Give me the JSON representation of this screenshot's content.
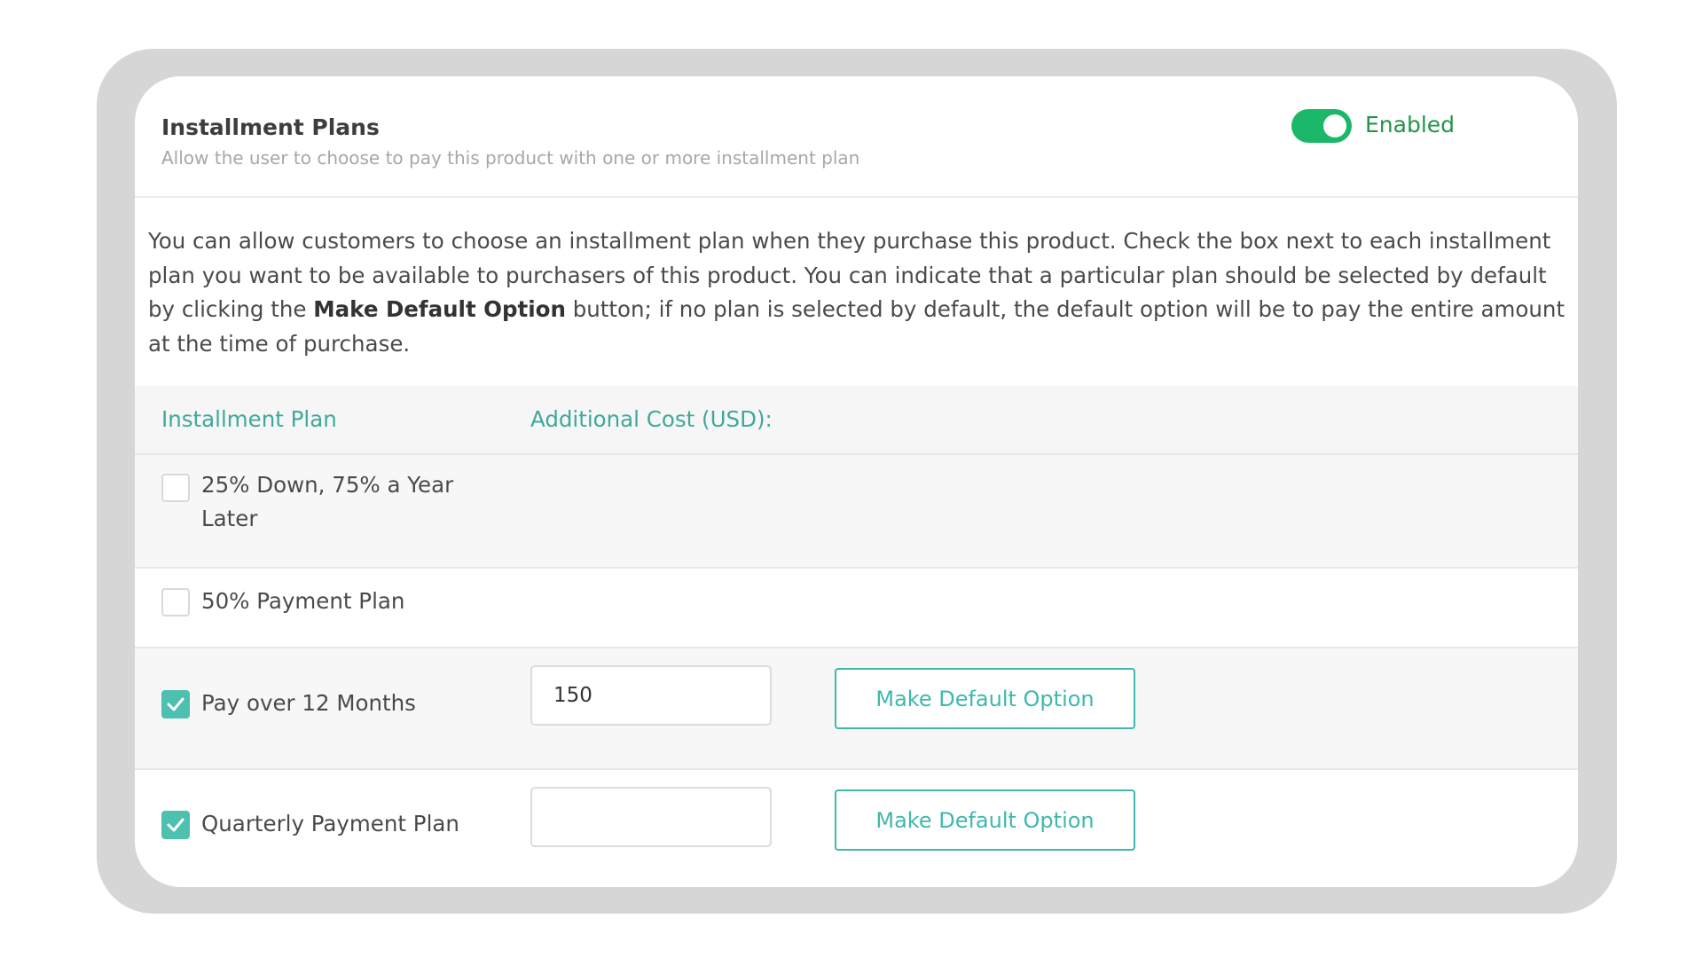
{
  "header": {
    "title": "Installment Plans",
    "subtitle": "Allow the user to choose to pay this product with one or more installment plan",
    "toggle_label": "Enabled",
    "toggle_on": true
  },
  "description": {
    "before_bold": "You can allow customers to choose an installment plan when they purchase this product. Check the box next to each installment plan you want to be available to purchasers of this product. You can indicate that a particular plan should be selected by default by clicking the ",
    "bold": "Make Default Option",
    "after_bold": " button; if no plan is selected by default, the default option will be to pay the entire amount at the time of purchase."
  },
  "table": {
    "col_plan": "Installment Plan",
    "col_cost": "Additional Cost (USD):",
    "rows": [
      {
        "label": "25% Down, 75% a Year Later",
        "checked": false
      },
      {
        "label": "50% Payment Plan",
        "checked": false
      },
      {
        "label": "Pay over 12 Months",
        "checked": true,
        "cost": "150",
        "button": "Make Default Option"
      },
      {
        "label": "Quarterly Payment Plan",
        "checked": true,
        "cost": "",
        "button": "Make Default Option"
      }
    ]
  },
  "colors": {
    "accent": "#3fb8ad",
    "toggle": "#1cb86a",
    "enabled_text": "#23954a"
  }
}
